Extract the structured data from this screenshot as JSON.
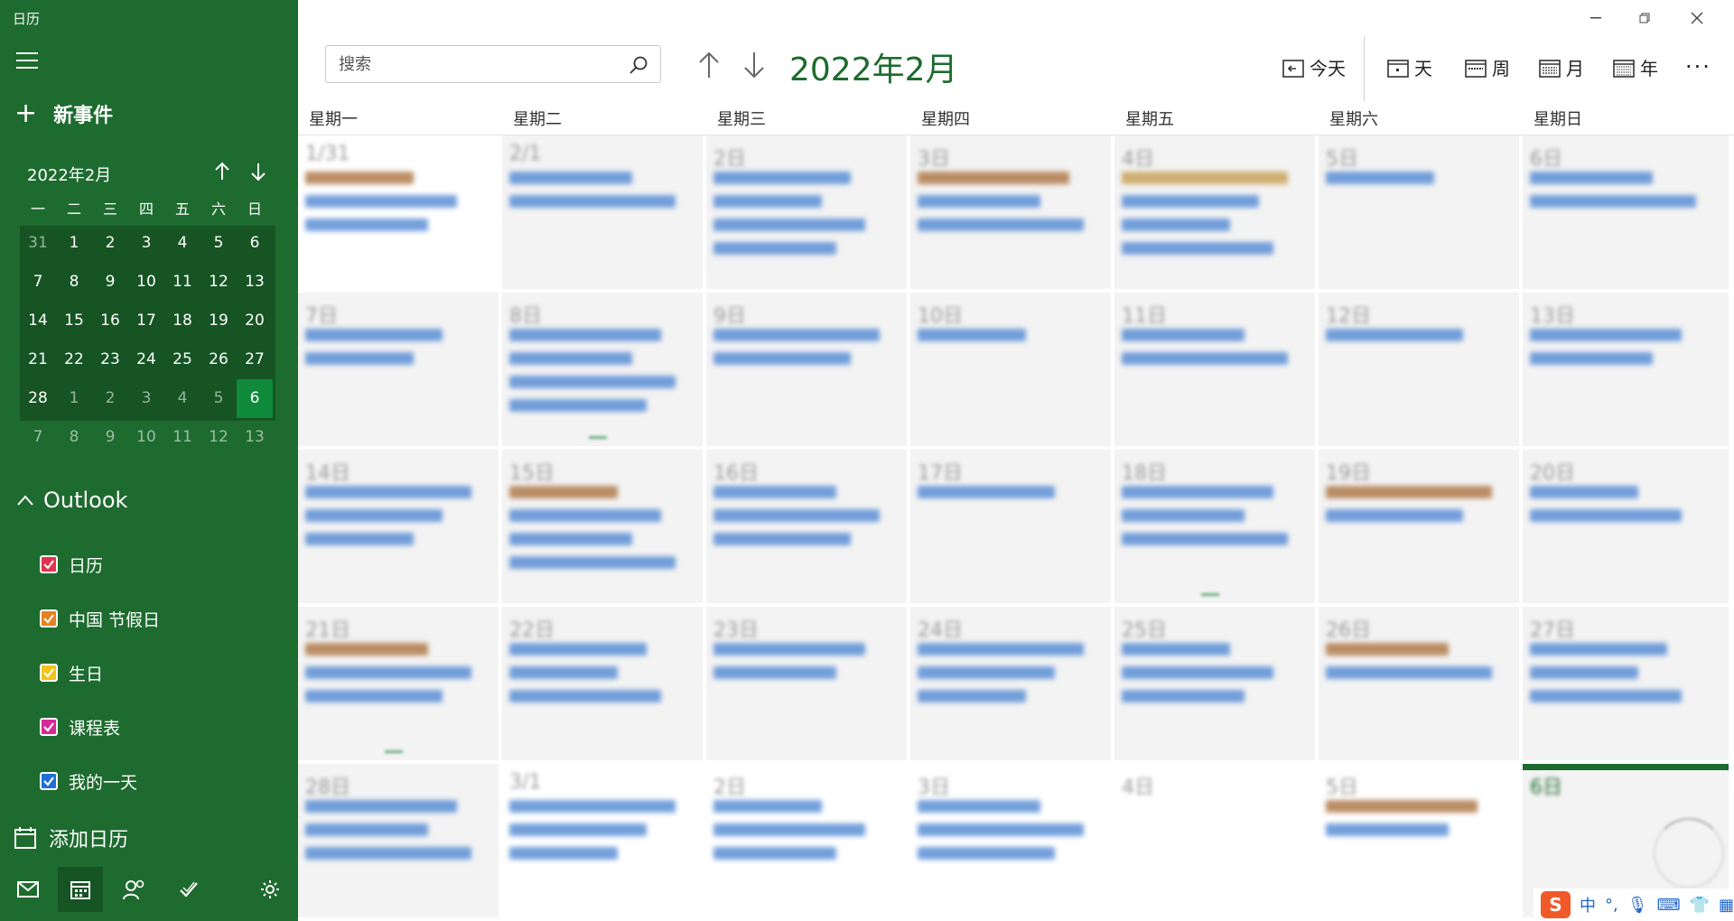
{
  "app": {
    "title": "日历"
  },
  "sidebar": {
    "new_event_label": "新事件",
    "mini": {
      "month": "2022年2月",
      "dows": [
        "一",
        "二",
        "三",
        "四",
        "五",
        "六",
        "日"
      ],
      "rows": [
        [
          "31",
          "1",
          "2",
          "3",
          "4",
          "5",
          "6"
        ],
        [
          "7",
          "8",
          "9",
          "10",
          "11",
          "12",
          "13"
        ],
        [
          "14",
          "15",
          "16",
          "17",
          "18",
          "19",
          "20"
        ],
        [
          "21",
          "22",
          "23",
          "24",
          "25",
          "26",
          "27"
        ],
        [
          "28",
          "1",
          "2",
          "3",
          "4",
          "5",
          "6"
        ],
        [
          "7",
          "8",
          "9",
          "10",
          "11",
          "12",
          "13"
        ]
      ]
    },
    "account": "Outlook",
    "calendars": [
      {
        "label": "日历",
        "color": "#e0324b"
      },
      {
        "label": "中国 节假日",
        "color": "#e8801f"
      },
      {
        "label": "生日",
        "color": "#f2c318"
      },
      {
        "label": "课程表",
        "color": "#d6279b"
      },
      {
        "label": "我的一天",
        "color": "#1f6fd6"
      }
    ],
    "add_calendar_label": "添加日历"
  },
  "header": {
    "search_placeholder": "搜索",
    "current_month": "2022年2月",
    "views": {
      "today": "今天",
      "day": "天",
      "week": "周",
      "month": "月",
      "year": "年"
    },
    "more": "···"
  },
  "month": {
    "weekdays": [
      "星期一",
      "星期二",
      "星期三",
      "星期四",
      "星期五",
      "星期六",
      "星期日"
    ],
    "weeks": [
      [
        "1/31",
        "2/1",
        "2日",
        "3日",
        "4日",
        "5日",
        "6日"
      ],
      [
        "7日",
        "8日",
        "9日",
        "10日",
        "11日",
        "12日",
        "13日"
      ],
      [
        "14日",
        "15日",
        "16日",
        "17日",
        "18日",
        "19日",
        "20日"
      ],
      [
        "21日",
        "22日",
        "23日",
        "24日",
        "25日",
        "26日",
        "27日"
      ],
      [
        "28日",
        "3/1",
        "2日",
        "3日",
        "4日",
        "5日",
        "6日"
      ]
    ]
  },
  "ime": {
    "logo": "S",
    "lang": "中"
  }
}
